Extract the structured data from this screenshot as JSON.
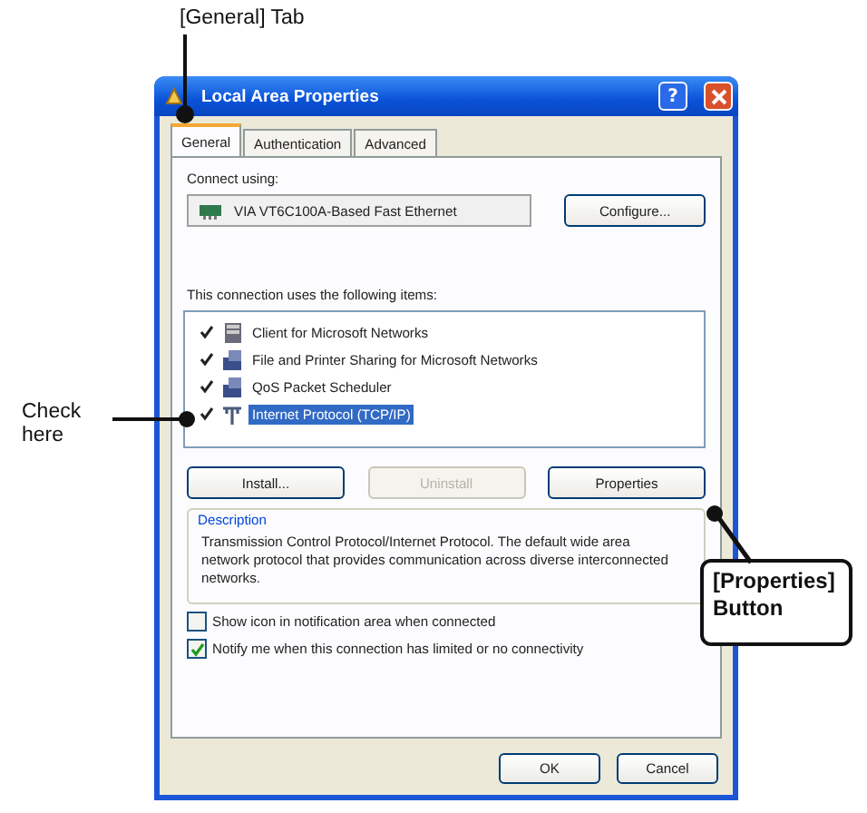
{
  "callouts": {
    "general_tab": "[General] Tab",
    "check_here": "Check here",
    "properties_button": "[Properties] Button"
  },
  "window": {
    "title": "Local Area Properties",
    "help_glyph": "?"
  },
  "tabs": [
    {
      "label": "General",
      "selected": true
    },
    {
      "label": "Authentication",
      "selected": false
    },
    {
      "label": "Advanced",
      "selected": false
    }
  ],
  "connect_using": {
    "label": "Connect using:",
    "adapter": "VIA VT6C100A-Based Fast Ethernet",
    "configure_button": "Configure..."
  },
  "items_label": "This connection uses the following items:",
  "items": [
    {
      "label": "Client for Microsoft Networks",
      "kind": "client",
      "checked": true,
      "selected": false
    },
    {
      "label": "File and Printer Sharing for Microsoft Networks",
      "kind": "service",
      "checked": true,
      "selected": false
    },
    {
      "label": "QoS Packet Scheduler",
      "kind": "service",
      "checked": true,
      "selected": false
    },
    {
      "label": "Internet Protocol (TCP/IP)",
      "kind": "protocol",
      "checked": true,
      "selected": true
    }
  ],
  "item_buttons": [
    {
      "label": "Install...",
      "disabled": false
    },
    {
      "label": "Uninstall",
      "disabled": true
    },
    {
      "label": "Properties",
      "disabled": false
    }
  ],
  "description": {
    "title": "Description",
    "text": "Transmission Control Protocol/Internet Protocol. The default wide area network protocol that provides communication across diverse interconnected networks."
  },
  "options": [
    {
      "label": "Show icon in notification area when connected",
      "checked": false
    },
    {
      "label": "Notify me when this connection has limited or no connectivity",
      "checked": true
    }
  ],
  "footer_buttons": [
    "OK",
    "Cancel"
  ]
}
